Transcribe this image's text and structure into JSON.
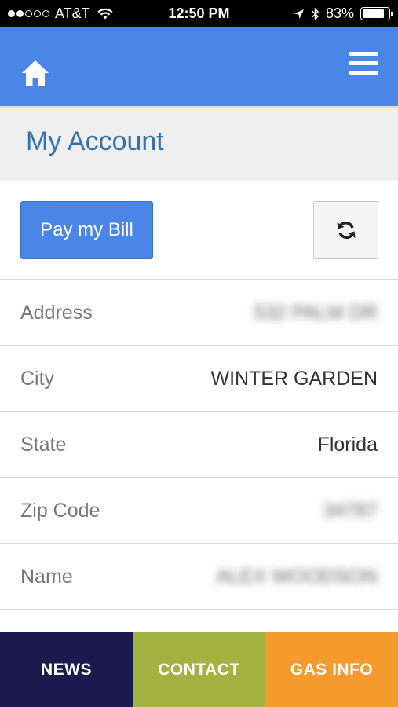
{
  "status_bar": {
    "carrier": "AT&T",
    "time": "12:50 PM",
    "battery": "83%",
    "signal_dots": 5,
    "signal_filled": 2,
    "battery_level": 0.83
  },
  "header": {
    "home_icon": "home-icon",
    "menu_icon": "hamburger-menu-icon",
    "color": "#4a86e8"
  },
  "page": {
    "title": "My Account"
  },
  "actions": {
    "pay_label": "Pay my Bill",
    "refresh_icon": "refresh-icon"
  },
  "account": {
    "rows": [
      {
        "label": "Address",
        "value": "532 PALM DR",
        "blurred": true
      },
      {
        "label": "City",
        "value": "WINTER GARDEN",
        "blurred": false
      },
      {
        "label": "State",
        "value": "Florida",
        "blurred": false
      },
      {
        "label": "Zip Code",
        "value": "34787",
        "blurred": true
      },
      {
        "label": "Name",
        "value": "ALEX WOODSON",
        "blurred": true
      }
    ]
  },
  "nav": {
    "news": "NEWS",
    "contact": "CONTACT",
    "gas_info": "GAS INFO",
    "colors": {
      "news": "#1a1a4e",
      "contact": "#a3b342",
      "gas_info": "#f59b2e"
    }
  }
}
